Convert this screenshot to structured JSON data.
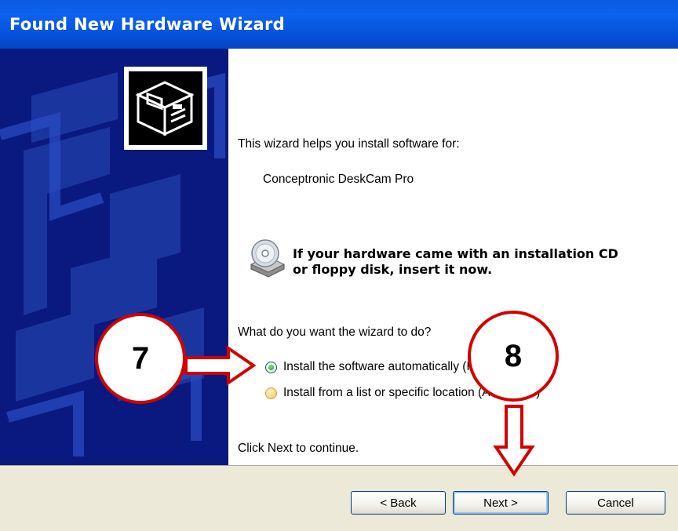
{
  "window": {
    "title": "Found New Hardware Wizard"
  },
  "wizard": {
    "intro": "This wizard helps you install software for:",
    "device_name": "Conceptronic DeskCam Pro",
    "cd_prompt_line1": "If your hardware came with an installation CD",
    "cd_prompt_line2": "or floppy disk, insert it now.",
    "question": "What do you want the wizard to do?",
    "options": [
      {
        "label": "Install the software automatically (Recommended)",
        "selected": true
      },
      {
        "label": "Install from a list or specific location (Advanced)",
        "selected": false
      }
    ],
    "continue_hint": "Click Next to continue."
  },
  "buttons": {
    "back": "< Back",
    "next": "Next >",
    "cancel": "Cancel"
  },
  "annotations": {
    "step7": "7",
    "step8": "8"
  },
  "colors": {
    "title_bar": "#0a5ae4",
    "side_panel": "#0a1980",
    "annotation_red": "#d40000",
    "dialog_face": "#ece9d8"
  },
  "icons": [
    "hardware-wizard-icon",
    "cd-drive-icon",
    "arrow-right-icon",
    "arrow-down-icon"
  ]
}
